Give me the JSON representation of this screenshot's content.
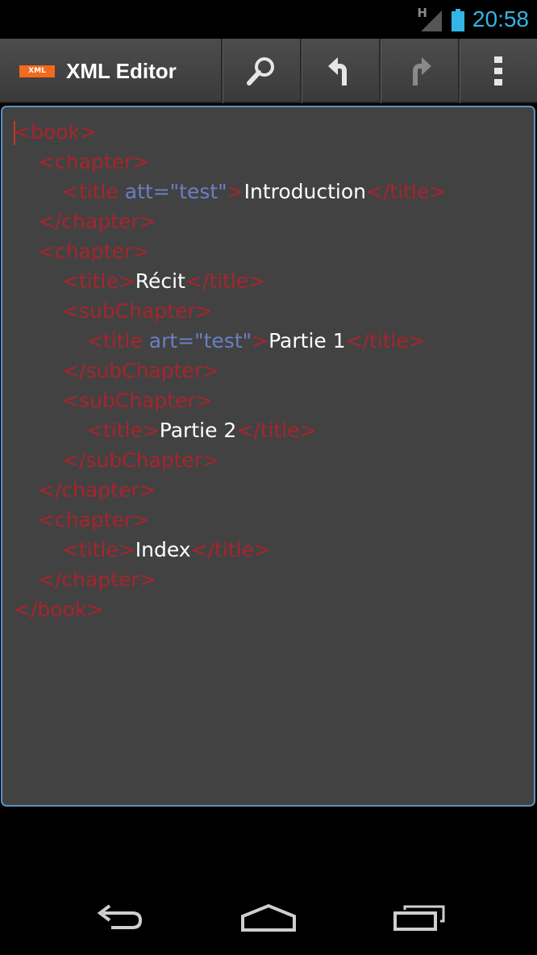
{
  "status": {
    "network": "H",
    "time": "20:58",
    "accent": "#33b5e5"
  },
  "actionbar": {
    "logo": "XML",
    "title": "XML Editor",
    "icons": [
      "search-icon",
      "undo-icon",
      "redo-icon",
      "overflow-menu-icon"
    ]
  },
  "editor": {
    "lines": [
      {
        "parts": [
          {
            "t": "tag",
            "v": "<book>"
          }
        ]
      },
      {
        "parts": [
          {
            "t": "tag",
            "v": "<chapter>"
          }
        ]
      },
      {
        "parts": [
          {
            "t": "tag",
            "v": "<title "
          },
          {
            "t": "attr",
            "v": "att=\"test\""
          },
          {
            "t": "tag",
            "v": ">"
          },
          {
            "t": "txt",
            "v": "Introduction"
          },
          {
            "t": "tag",
            "v": "</title>"
          }
        ]
      },
      {
        "parts": [
          {
            "t": "tag",
            "v": "</chapter>"
          }
        ]
      },
      {
        "parts": [
          {
            "t": "tag",
            "v": "<chapter>"
          }
        ]
      },
      {
        "parts": [
          {
            "t": "tag",
            "v": "<title>"
          },
          {
            "t": "txt",
            "v": "Récit"
          },
          {
            "t": "tag",
            "v": "</title>"
          }
        ]
      },
      {
        "parts": [
          {
            "t": "tag",
            "v": "<subChapter>"
          }
        ]
      },
      {
        "parts": [
          {
            "t": "tag",
            "v": "<title "
          },
          {
            "t": "attr",
            "v": "art=\"test\""
          },
          {
            "t": "tag",
            "v": ">"
          },
          {
            "t": "txt",
            "v": "Partie 1"
          },
          {
            "t": "tag",
            "v": "</title>"
          }
        ]
      },
      {
        "parts": [
          {
            "t": "tag",
            "v": "</subChapter>"
          }
        ]
      },
      {
        "parts": [
          {
            "t": "tag",
            "v": "<subChapter>"
          }
        ]
      },
      {
        "parts": [
          {
            "t": "tag",
            "v": "<title>"
          },
          {
            "t": "txt",
            "v": "Partie 2"
          },
          {
            "t": "tag",
            "v": "</title>"
          }
        ]
      },
      {
        "parts": [
          {
            "t": "tag",
            "v": "</subChapter>"
          }
        ]
      },
      {
        "parts": [
          {
            "t": "tag",
            "v": "</chapter>"
          }
        ]
      },
      {
        "parts": [
          {
            "t": "tag",
            "v": "<chapter>"
          }
        ]
      },
      {
        "parts": [
          {
            "t": "tag",
            "v": "<title>"
          },
          {
            "t": "txt",
            "v": "Index"
          },
          {
            "t": "tag",
            "v": "</title>"
          }
        ]
      },
      {
        "parts": [
          {
            "t": "tag",
            "v": "</chapter>"
          }
        ]
      },
      {
        "parts": [
          {
            "t": "tag",
            "v": "</book>"
          }
        ]
      }
    ],
    "colors": {
      "tag": "#a8242c",
      "attr": "#6a7fc4",
      "text": "#ffffff",
      "border": "#5d8fc2"
    }
  },
  "navbar": {
    "icons": [
      "back-icon",
      "home-icon",
      "recent-apps-icon"
    ]
  }
}
